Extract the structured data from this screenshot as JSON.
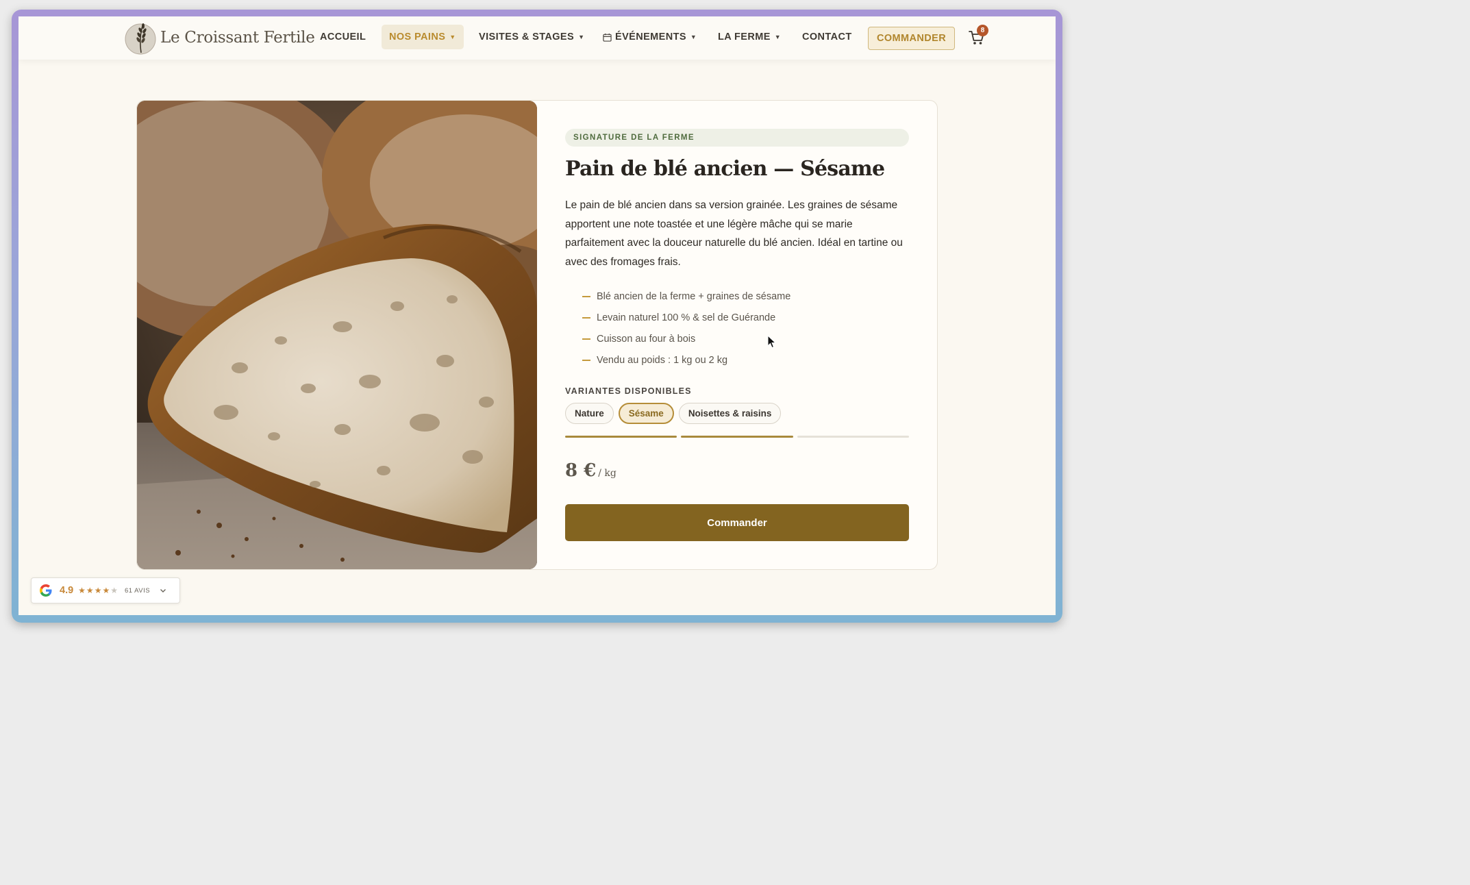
{
  "brand": {
    "name": "Le Croissant Fertile"
  },
  "nav": {
    "items": [
      {
        "label": "ACCUEIL"
      },
      {
        "label": "NOS PAINS"
      },
      {
        "label": "VISITES & STAGES"
      },
      {
        "label": "ÉVÉNEMENTS"
      },
      {
        "label": "LA FERME"
      },
      {
        "label": "CONTACT"
      }
    ],
    "cta": "COMMANDER",
    "cart_count": "8",
    "active": "NOS PAINS"
  },
  "product": {
    "image_alt": "Pain de blé ancien coupé",
    "tag": "SIGNATURE DE LA FERME",
    "title": "Pain de blé ancien — Sésame",
    "description": "Le pain de blé ancien dans sa version grainée. Les graines de sésame apportent une note toastée et une légère mâche qui se marie parfaitement avec la douceur naturelle du blé ancien. Idéal en tartine ou avec des fromages frais.",
    "features": [
      "Blé ancien de la ferme + graines de sésame",
      "Levain naturel 100 % & sel de Guérande",
      "Cuisson au four à bois",
      "Vendu au poids : 1 kg ou 2 kg"
    ],
    "variants_label": "VARIANTES DISPONIBLES",
    "variants": [
      "Nature",
      "Sésame",
      "Noisettes & raisins"
    ],
    "selected_variant": "Sésame",
    "carousel_progress": "2 of 3",
    "price": "8 €",
    "price_unit": "/ kg",
    "order_label": "Commander"
  },
  "google_reviews": {
    "rating": "4.9",
    "stars": 4,
    "count_label": "61 AVIS"
  },
  "colors": {
    "accent_gold": "#b98b2e",
    "button_brown": "#836420",
    "tag_green": "#4f6b3e",
    "badge_red": "#b5562a"
  }
}
